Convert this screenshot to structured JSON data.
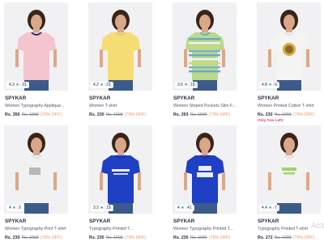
{
  "colors": {
    "rating_star": "#14958f",
    "brand_text": "#282c3f",
    "discount_text": "#ff905a",
    "alert_text": "#ff3e6c",
    "mrp_text": "#7e818c"
  },
  "products": [
    {
      "brand": "SPYKAR",
      "name": "Women Typography Applique...",
      "price": "Rs. 356",
      "mrp": "Rs. 1099",
      "discount": "(70% OFF)",
      "rating": "4.3",
      "rating_count": "31",
      "shirt_color": "#f4c4cf",
      "trim_color": "#1b2a55",
      "print": "none",
      "alert": ""
    },
    {
      "brand": "SPYKAR",
      "name": "Women T-shirt",
      "price": "Rs. 230",
      "mrp": "Rs. 1099",
      "discount": "(79% OFF)",
      "rating": "4.2",
      "rating_count": "21",
      "shirt_color": "#f5dd74",
      "trim_color": "#e9c95e",
      "print": "none",
      "alert": ""
    },
    {
      "brand": "SPYKAR",
      "name": "Women Striped Pockets Slim F...",
      "price": "Rs. 293",
      "mrp": "Rs. 1099",
      "discount": "(73% OFF)",
      "rating": "3.6",
      "rating_count": "15",
      "shirt_color": "#b9d98c",
      "trim_color": "#6aa7c4",
      "print": "stripes",
      "alert": ""
    },
    {
      "brand": "SPYKAR",
      "name": "Women Printed Cotton T-shirt",
      "price": "Rs. 230",
      "mrp": "Rs. 1099",
      "discount": "(79% OFF)",
      "rating": "4.8",
      "rating_count": "6",
      "shirt_color": "#f4f4f2",
      "trim_color": "#e2e2e2",
      "print": "gold-circle",
      "alert": "Only Few Left!"
    },
    {
      "brand": "SPYKAR",
      "name": "Women Typography Print T-shirt",
      "price": "Rs. 230",
      "mrp": "Rs. 1099",
      "discount": "(79% OFF)",
      "rating": "4",
      "rating_count": "9",
      "shirt_color": "#f1f1f1",
      "trim_color": "#dedede",
      "print": "grey-type",
      "alert": ""
    },
    {
      "brand": "SPYKAR",
      "name": "Typography Printed T...",
      "price": "Rs. 230",
      "mrp": "Rs. 1099",
      "discount": "(79% OFF)",
      "rating": "3.2",
      "rating_count": "15",
      "shirt_color": "#1f3fc4",
      "trim_color": "#1a35a6",
      "print": "white-type",
      "alert": ""
    },
    {
      "brand": "SPYKAR",
      "name": "Women Typography Printed T...",
      "price": "Rs. 230",
      "mrp": "Rs. 1099",
      "discount": "(79% OFF)",
      "rating": "4",
      "rating_count": "41",
      "shirt_color": "#1f3fc4",
      "trim_color": "#1a35a6",
      "print": "love",
      "alert": ""
    },
    {
      "brand": "SPYKAR",
      "name": "Typography Printed T-shirt",
      "price": "Rs. 272",
      "mrp": "Rs. 1099",
      "discount": "(75% OFF)",
      "rating": "4.4",
      "rating_count": "7",
      "shirt_color": "#f2f2f2",
      "trim_color": "#dcdcdc",
      "print": "green-type",
      "alert": ""
    }
  ],
  "watermark": "Activ"
}
